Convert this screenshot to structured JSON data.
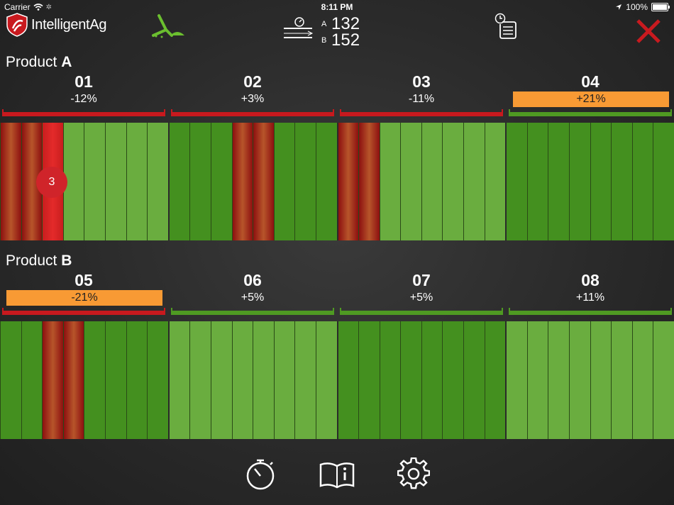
{
  "status_bar": {
    "carrier": "Carrier",
    "time": "8:11 PM",
    "battery": "100%"
  },
  "header": {
    "brand": "IntelligentAg",
    "speed": {
      "a_label": "A",
      "a_value": "132",
      "b_label": "B",
      "b_value": "152"
    }
  },
  "product_a": {
    "label_prefix": "Product",
    "label_letter": "A",
    "sections": [
      {
        "num": "01",
        "pct": "-12%",
        "status": "red"
      },
      {
        "num": "02",
        "pct": "+3%",
        "status": "red"
      },
      {
        "num": "03",
        "pct": "-11%",
        "status": "red"
      },
      {
        "num": "04",
        "pct": "+21%",
        "status": "orange"
      }
    ],
    "alert_count": "3"
  },
  "product_b": {
    "label_prefix": "Product",
    "label_letter": "B",
    "sections": [
      {
        "num": "05",
        "pct": "-21%",
        "status": "orange"
      },
      {
        "num": "06",
        "pct": "+5%",
        "status": "green"
      },
      {
        "num": "07",
        "pct": "+5%",
        "status": "green"
      },
      {
        "num": "08",
        "pct": "+11%",
        "status": "green"
      }
    ]
  },
  "colors": {
    "red": "#c8191e",
    "green": "#4f9a22",
    "orange": "#f89a34",
    "close": "#c81a1f"
  },
  "icons": [
    "planter-icon",
    "speed-icon",
    "report-icon",
    "close-icon",
    "stopwatch-icon",
    "book-info-icon",
    "gear-icon"
  ]
}
